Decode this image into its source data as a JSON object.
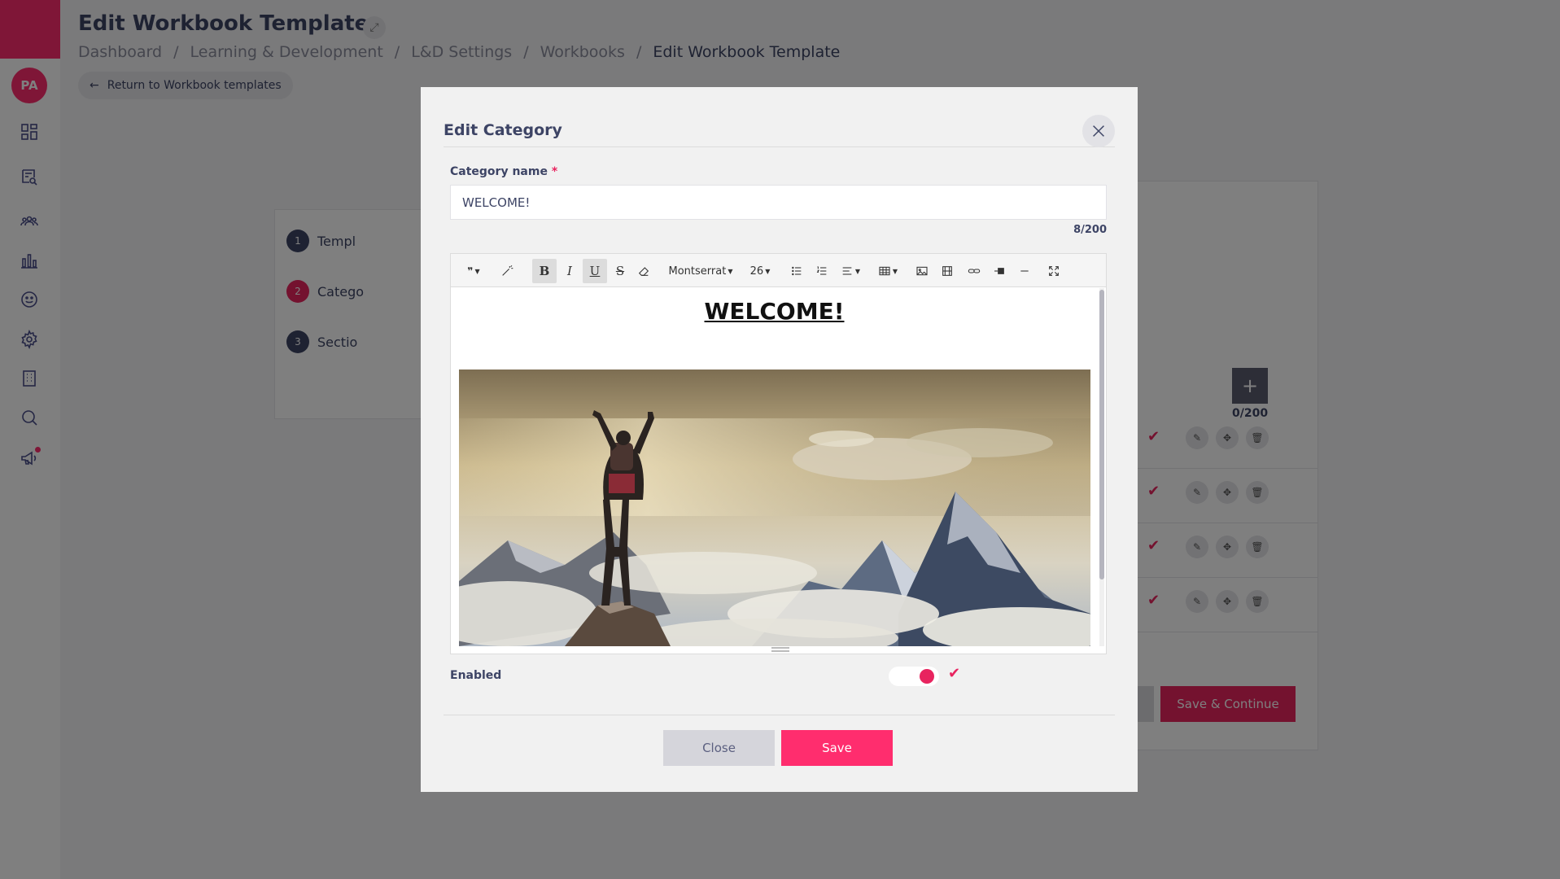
{
  "sidebar": {
    "avatar_initials": "PA",
    "nav_icons": [
      "dashboard-icon",
      "search-document-icon",
      "people-icon",
      "chart-icon",
      "smiley-icon",
      "gear-icon",
      "building-icon",
      "search-icon",
      "megaphone-icon"
    ]
  },
  "header": {
    "title": "Edit Workbook Template",
    "breadcrumb": [
      "Dashboard",
      "Learning & Development",
      "L&D Settings",
      "Workbooks",
      "Edit Workbook Template"
    ],
    "separator": "/",
    "return_label": "Return to Workbook templates"
  },
  "steps": [
    {
      "number": "1",
      "label": "Templ"
    },
    {
      "number": "2",
      "label": "Catego"
    },
    {
      "number": "3",
      "label": "Sectio"
    }
  ],
  "right_panel": {
    "counter": "0/200",
    "save_continue_label": "Save & Continue"
  },
  "modal": {
    "title": "Edit Category",
    "category_name_label": "Category name",
    "required_mark": "*",
    "category_name_value": "WELCOME!",
    "char_count": "8/200",
    "toolbar": {
      "font_family": "Montserrat",
      "font_size": "26"
    },
    "editor_heading": "WELCOME!",
    "enabled_label": "Enabled",
    "enabled": true,
    "close_label": "Close",
    "save_label": "Save"
  },
  "colors": {
    "brand": "#ff2d6e",
    "accent": "#e8245f",
    "text": "#3d4465"
  }
}
